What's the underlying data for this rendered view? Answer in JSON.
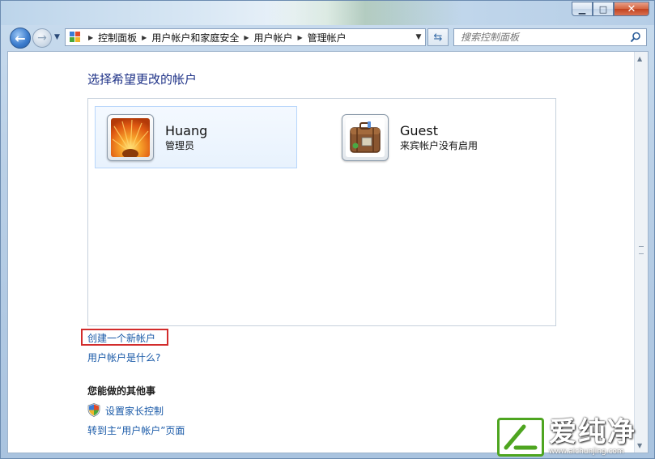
{
  "breadcrumb": [
    "控制面板",
    "用户帐户和家庭安全",
    "用户帐户",
    "管理帐户"
  ],
  "search": {
    "placeholder": "搜索控制面板"
  },
  "window_controls": {
    "minimize": "▁",
    "maximize": "□",
    "close": "✕"
  },
  "main": {
    "heading": "选择希望更改的帐户",
    "accounts": [
      {
        "name": "Huang",
        "role": "管理员",
        "selected": true
      },
      {
        "name": "Guest",
        "role": "来宾帐户没有启用",
        "selected": false
      }
    ],
    "links": {
      "create_account": "创建一个新帐户",
      "what_is_account": "用户帐户是什么?",
      "parental_controls": "设置家长控制",
      "goto_user_accounts": "转到主“用户帐户”页面"
    },
    "other_things_heading": "您能做的其他事"
  },
  "watermark": {
    "brand": "爱纯净",
    "url": "www.aichunjing.com"
  },
  "colors": {
    "heading": "#1e3287",
    "link": "#1a5aa8",
    "highlight": "#d22c2c",
    "brand_green": "#4ea520"
  }
}
